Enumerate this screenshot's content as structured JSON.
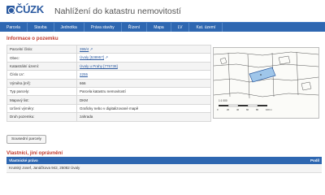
{
  "header": {
    "logo_text": "ČÚZK",
    "site_title": "Nahlížení do katastru nemovitostí"
  },
  "nav": {
    "items": [
      {
        "label": "Parcela"
      },
      {
        "label": "Stavba"
      },
      {
        "label": "Jednotka"
      },
      {
        "label": "Práva stavby"
      },
      {
        "label": "Řízení"
      },
      {
        "label": "Mapa"
      },
      {
        "label": "LV"
      },
      {
        "label": "Kat. území"
      }
    ]
  },
  "parcel_info": {
    "title": "Informace o pozemku",
    "rows": [
      {
        "label": "Parcelní číslo:",
        "value": "399/4"
      },
      {
        "label": "Obec:",
        "value": "Úvaly [538957]"
      },
      {
        "label": "Katastrální území:",
        "value": "Úvaly u Prahy [775738]"
      },
      {
        "label": "Číslo LV:",
        "value": "2255"
      },
      {
        "label": "Výměra [m²]:",
        "value": "666"
      },
      {
        "label": "Typ parcely:",
        "value": "Parcela katastru nemovitostí"
      },
      {
        "label": "Mapový list:",
        "value": "DKM"
      },
      {
        "label": "Určení výměry:",
        "value": "Graficky nebo v digitalizované mapě"
      },
      {
        "label": "Druh pozemku:",
        "value": "zahrada"
      }
    ]
  },
  "map": {
    "scale_text": "1:1 000",
    "scale_ticks": [
      "0",
      "20",
      "40",
      "60",
      "80",
      "100 m"
    ]
  },
  "neighbors_button": {
    "label": "Sousední parcely"
  },
  "ownership": {
    "title": "Vlastníci, jiní oprávnění",
    "columns": [
      "Vlastnické právo",
      "Podíl"
    ],
    "rows": [
      {
        "owner": "Krutský Josef, Janáčkova 942, 25082 Úvaly",
        "share": ""
      }
    ]
  },
  "colors": {
    "nav_bg": "#2e67b1",
    "section_title": "#c0392b",
    "link": "#2b5aa0",
    "parcel_highlight": "#9fc6ea"
  }
}
